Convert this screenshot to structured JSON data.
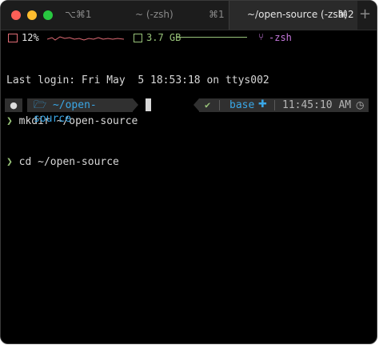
{
  "tabs": [
    {
      "shortcut_left": "⌥⌘1",
      "title": "~ (-zsh)",
      "shortcut": "⌘1",
      "active": false
    },
    {
      "title": "~/open-source (-zsh)",
      "shortcut": "⌘2",
      "active": true
    }
  ],
  "new_tab_label": "+",
  "status_bar": {
    "cpu": "12%",
    "memory": "3.7 GB",
    "branch": "-zsh"
  },
  "terminal": {
    "last_login": "Last login: Fri May  5 18:53:18 on ttys002",
    "history": [
      {
        "arrow": "❯",
        "command": "mkdir ~/open-source"
      },
      {
        "arrow": "❯",
        "command": "cd ~/open-source"
      }
    ]
  },
  "prompt": {
    "os_icon": "",
    "dir_icon": "🗁",
    "directory": "~/open-source",
    "status_check": "✔",
    "env_name": "base",
    "env_icon": "🐍",
    "time": "11:45:10 AM",
    "clock_icon": "◷"
  },
  "colors": {
    "background": "#000000",
    "cpu": "#e06c75",
    "memory": "#98c379",
    "branch": "#c678dd",
    "directory": "#3aa8e8",
    "prompt_arrow": "#98c379"
  }
}
